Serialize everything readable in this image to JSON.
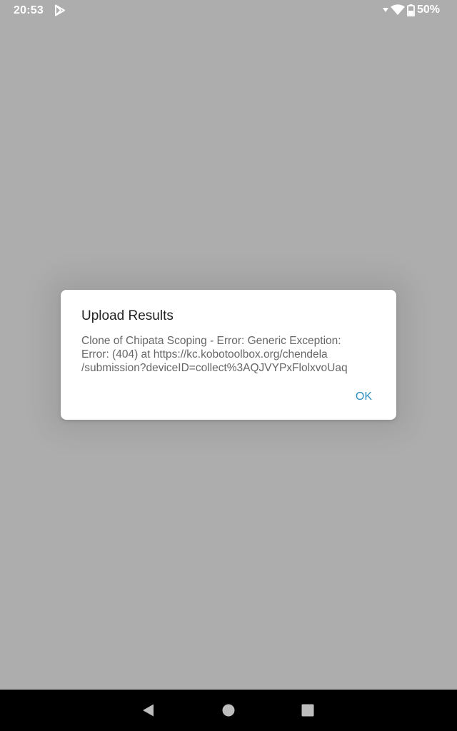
{
  "status_bar": {
    "time": "20:53",
    "battery": "50%",
    "icons": [
      "play-store-icon",
      "signal-icon",
      "wifi-icon",
      "battery-icon"
    ]
  },
  "dialog": {
    "title": "Upload Results",
    "message": "Clone of Chipata Scoping - Error: Generic Exception:\nError:  (404) at https://kc.kobotoolbox.org/chendela\n/submission?deviceID=collect%3AQJVYPxFlolxvoUaq",
    "ok_label": "OK"
  },
  "navigation": {
    "icons": [
      "back-icon",
      "home-icon",
      "recents-icon"
    ]
  },
  "colors": {
    "background": "#adadad",
    "dialog": "#ffffff",
    "accent": "#2e8fbf",
    "nav_bar": "#000000"
  }
}
